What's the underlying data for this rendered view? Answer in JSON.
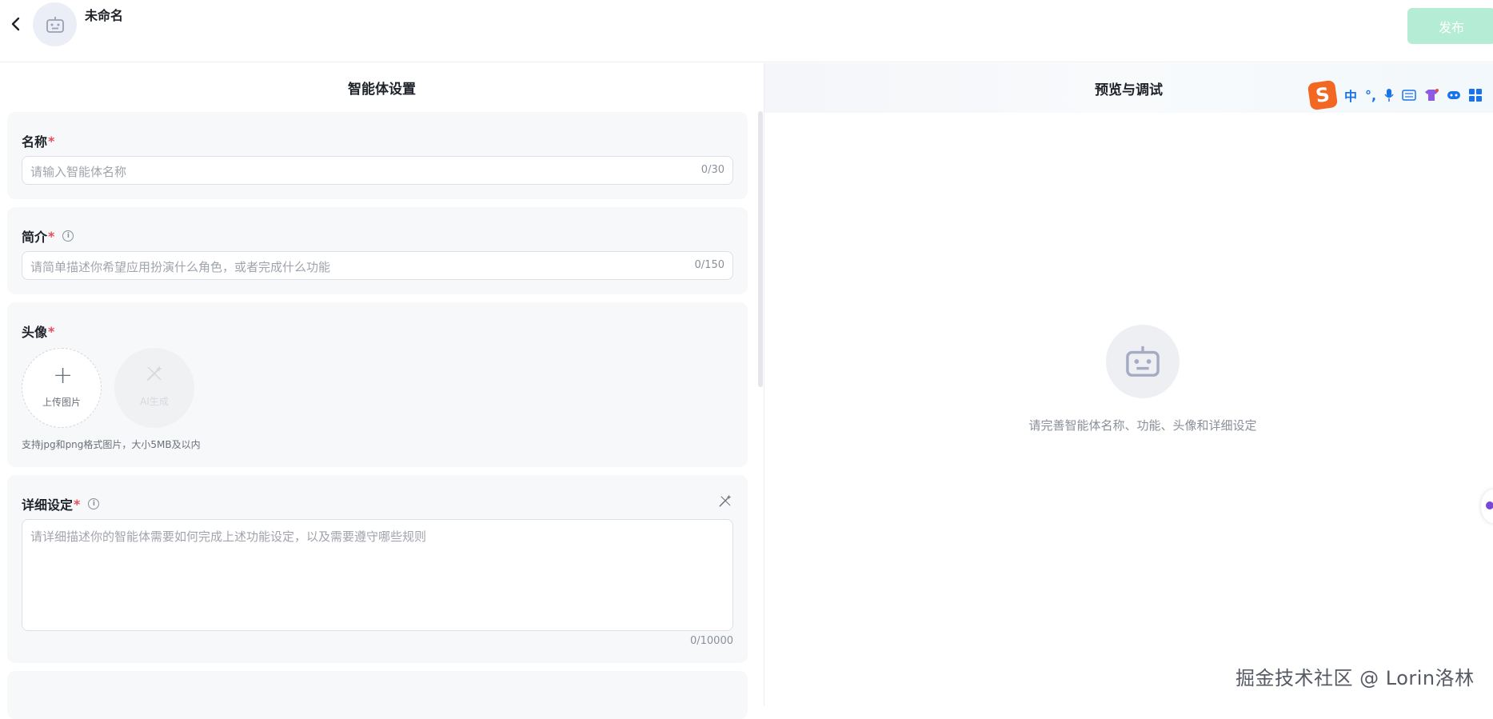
{
  "header": {
    "agent_name": "未命名",
    "publish_label": "发布"
  },
  "left_panel": {
    "title": "智能体设置",
    "name_field": {
      "label": "名称",
      "required_mark": "*",
      "placeholder": "请输入智能体名称",
      "counter": "0/30"
    },
    "intro_field": {
      "label": "简介",
      "required_mark": "*",
      "placeholder": "请简单描述你希望应用扮演什么角色，或者完成什么功能",
      "counter": "0/150"
    },
    "avatar_field": {
      "label": "头像",
      "required_mark": "*",
      "upload_label": "上传图片",
      "ai_label": "AI生成",
      "hint": "支持jpg和png格式图片，大小5MB及以内"
    },
    "detail_field": {
      "label": "详细设定",
      "required_mark": "*",
      "placeholder": "请详细描述你的智能体需要如何完成上述功能设定，以及需要遵守哪些规则",
      "counter": "0/10000"
    }
  },
  "right_panel": {
    "title": "预览与调试",
    "empty_text": "请完善智能体名称、功能、头像和详细设定"
  },
  "ime_toolbar": {
    "logo": "S",
    "lang": "中"
  },
  "watermark": "掘金技术社区 @ Lorin洛林",
  "colors": {
    "publish_bg": "#b4ecd6",
    "required": "#e34d59",
    "card_bg": "#f7f8fa",
    "ime_accent": "#1a73e8"
  }
}
